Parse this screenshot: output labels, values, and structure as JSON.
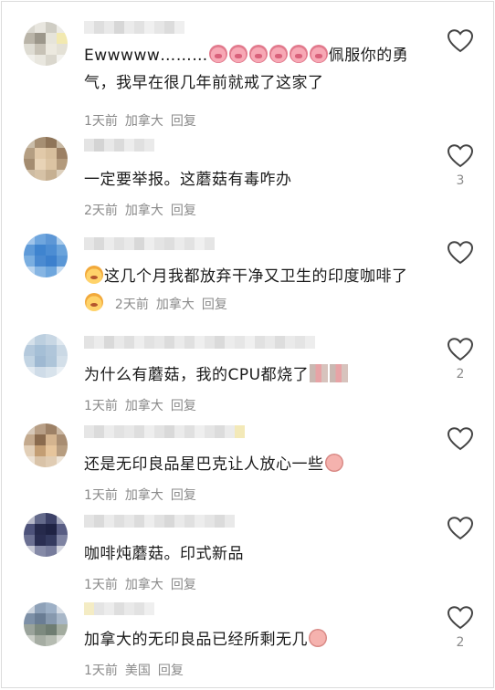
{
  "comments": [
    {
      "text_prefix": "Ewwwww………",
      "text_suffix": "佩服你的勇气，我早在很几年前就戒了这家了",
      "time": "1天前",
      "location": "加拿大",
      "reply": "回复",
      "likes": "",
      "emoji_icons": [
        "pig-face-icon",
        "pig-face-icon",
        "pig-face-icon",
        "pig-face-icon",
        "pig-face-icon",
        "pig-face-icon"
      ]
    },
    {
      "text": "一定要举报。这蘑菇有毒咋办",
      "time": "2天前",
      "location": "加拿大",
      "reply": "回复",
      "likes": "3"
    },
    {
      "text_prefix": "这几个月我都放弃干净又卫生的印度咖啡了",
      "time": "2天前",
      "location": "加拿大",
      "reply": "回复",
      "likes": "",
      "emoji_icons": [
        "fox-face-icon",
        "fox-face-icon"
      ]
    },
    {
      "text": "为什么有蘑菇，我的CPU都烧了",
      "time": "1天前",
      "location": "加拿大",
      "reply": "回复",
      "likes": "2",
      "emoji_icons": [
        "sticker-icon",
        "sticker-icon"
      ]
    },
    {
      "text": "还是无印良品星巴克让人放心一些",
      "time": "1天前",
      "location": "加拿大",
      "reply": "回复",
      "likes": "",
      "emoji_icons": [
        "crying-pig-icon"
      ]
    },
    {
      "text": "咖啡炖蘑菇。印式新品",
      "time": "1天前",
      "location": "加拿大",
      "reply": "回复",
      "likes": ""
    },
    {
      "text": "加拿大的无印良品已经所剩无几",
      "time": "1天前",
      "location": "美国",
      "reply": "回复",
      "likes": "2",
      "emoji_icons": [
        "crying-pig-icon"
      ]
    }
  ],
  "colors": {
    "text": "#1a1a1a",
    "meta": "#8a8a8a",
    "heart_stroke": "#444444"
  }
}
